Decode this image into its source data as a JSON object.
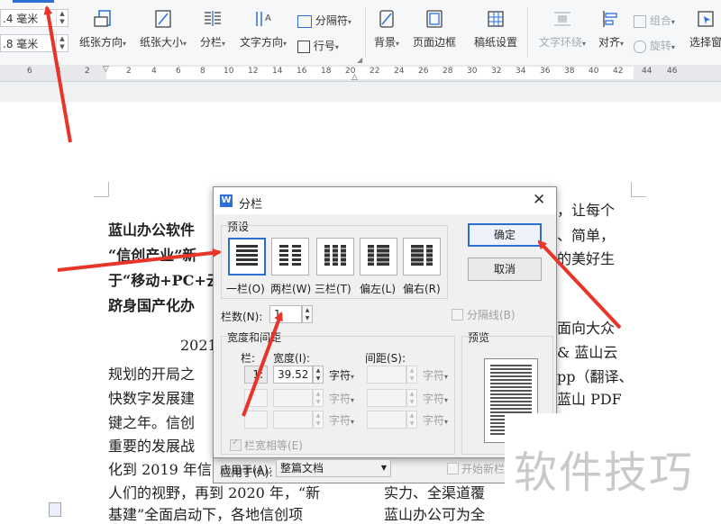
{
  "ribbon": {
    "spin1": {
      "value": ".4 毫米"
    },
    "spin2": {
      "value": ".8 毫米"
    },
    "buttons": [
      {
        "label": "纸张方向",
        "icon": "page-orientation-icon"
      },
      {
        "label": "纸张大小",
        "icon": "page-size-icon"
      },
      {
        "label": "分栏",
        "icon": "columns-icon"
      },
      {
        "label": "文字方向",
        "icon": "text-direction-icon"
      },
      {
        "label": "分隔符",
        "icon": "separator-icon"
      },
      {
        "label": "行号",
        "icon": "line-number-icon"
      },
      {
        "label": "背景",
        "icon": "background-icon"
      },
      {
        "label": "页面边框",
        "icon": "page-border-icon"
      },
      {
        "label": "稿纸设置",
        "icon": "manuscript-icon"
      },
      {
        "label": "文字环绕",
        "icon": "text-wrap-icon"
      },
      {
        "label": "对齐",
        "icon": "align-icon"
      },
      {
        "label": "组合",
        "icon": "group-icon"
      },
      {
        "label": "旋转",
        "icon": "rotate-icon"
      },
      {
        "label": "选择窗",
        "icon": "selection-pane-icon"
      }
    ]
  },
  "ruler": {
    "ticks": [
      "6",
      "4",
      "2",
      "2",
      "4",
      "6",
      "8",
      "10",
      "12",
      "14",
      "16",
      "18",
      "20",
      "22",
      "24",
      "26",
      "28",
      "30",
      "32",
      "34",
      "36",
      "38",
      "40",
      "42",
      "44",
      "46"
    ]
  },
  "document": {
    "left_lines": [
      "蓝山办公软件",
      "“信创产业”新",
      "于“移动+PC+云",
      "跻身国产化办"
    ],
    "right_lines": [
      "，让每个",
      "、简单，",
      "的美好生"
    ],
    "para_left": [
      "2021",
      "规划的开局之",
      "快数字发展建",
      "键之年。信创",
      "重要的发展战",
      "化到 2019 年信",
      "人们的视野，再到 2020 年，“新",
      "基建”全面启动下，各地信创项"
    ],
    "para_right": [
      "面向大众",
      "& 蓝山云",
      "pp（翻译、",
      "蓝山 PDF",
      "实力、全渠道覆",
      "蓝山办公可为全"
    ]
  },
  "dialog": {
    "title": "分栏",
    "preset_label": "预设",
    "presets": [
      "一栏(O)",
      "两栏(W)",
      "三栏(T)",
      "偏左(L)",
      "偏右(R)"
    ],
    "ok": "确定",
    "cancel": "取消",
    "count_label": "栏数(N):",
    "count_value": "1",
    "separator_label": "分隔线(B)",
    "width_spacing_label": "宽度和间距",
    "col_header": "栏:",
    "width_header": "宽度(I):",
    "spacing_header": "间距(S):",
    "row1_index": "1:",
    "row1_width": "39.52",
    "unit": "字符",
    "equal_width_label": "栏宽相等(E)",
    "preview_label": "预览",
    "apply_label": "应用于(A):",
    "apply_value": "整篇文档",
    "new_col_label": "开始新栏(U)"
  },
  "watermark": {
    "text": "软件技巧"
  },
  "colors": {
    "accent": "#2b6fd6",
    "arrow": "#e8352a"
  }
}
